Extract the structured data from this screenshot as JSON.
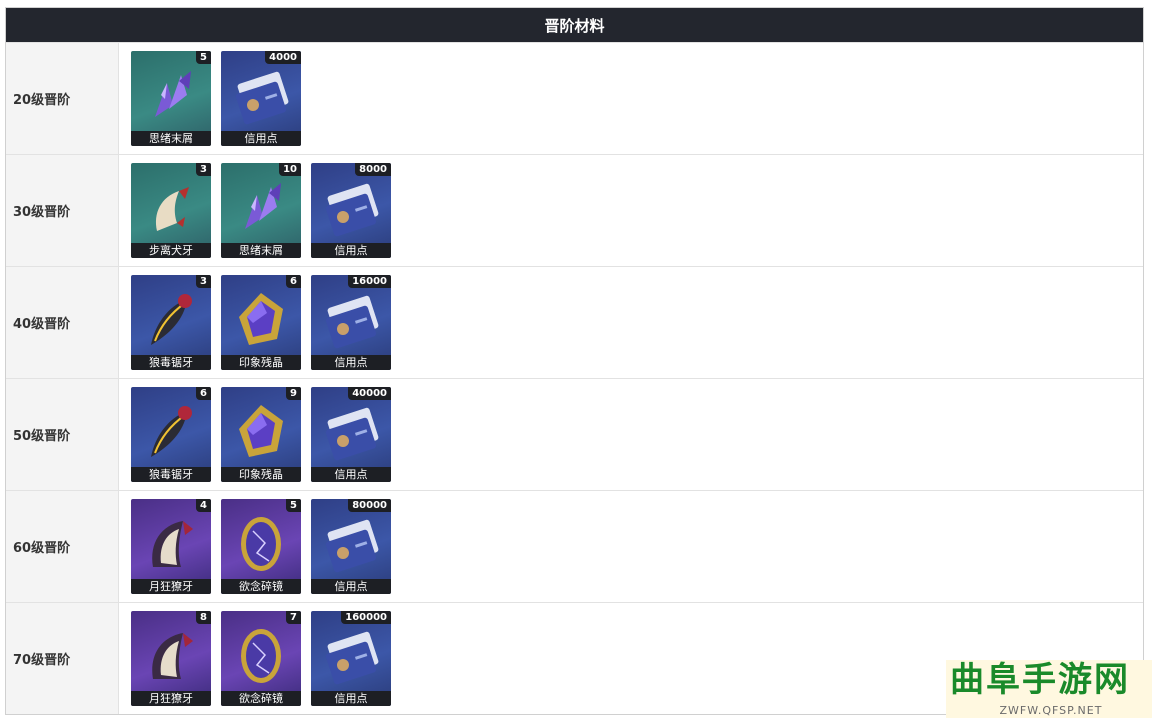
{
  "header": {
    "title": "晋阶材料"
  },
  "colors": {
    "header_bg": "#23262e",
    "teal": "#2c6f6b",
    "blue": "#3c57a8",
    "purple": "#6a45b4"
  },
  "rows": [
    {
      "label": "20级晋阶",
      "items": [
        {
          "name": "思绪末屑",
          "count": "5",
          "icon": "purple-crystal-shards-icon",
          "bg": "teal"
        },
        {
          "name": "信用点",
          "count": "4000",
          "icon": "credit-card-icon",
          "bg": "blue"
        }
      ]
    },
    {
      "label": "30级晋阶",
      "items": [
        {
          "name": "步离犬牙",
          "count": "3",
          "icon": "fang-icon",
          "bg": "teal"
        },
        {
          "name": "思绪末屑",
          "count": "10",
          "icon": "purple-crystal-shards-icon",
          "bg": "teal"
        },
        {
          "name": "信用点",
          "count": "8000",
          "icon": "credit-card-icon",
          "bg": "blue"
        }
      ]
    },
    {
      "label": "40级晋阶",
      "items": [
        {
          "name": "狼毒锯牙",
          "count": "3",
          "icon": "serrated-fang-icon",
          "bg": "blue"
        },
        {
          "name": "印象残晶",
          "count": "6",
          "icon": "gold-crystal-icon",
          "bg": "blue"
        },
        {
          "name": "信用点",
          "count": "16000",
          "icon": "credit-card-icon",
          "bg": "blue"
        }
      ]
    },
    {
      "label": "50级晋阶",
      "items": [
        {
          "name": "狼毒锯牙",
          "count": "6",
          "icon": "serrated-fang-icon",
          "bg": "blue"
        },
        {
          "name": "印象残晶",
          "count": "9",
          "icon": "gold-crystal-icon",
          "bg": "blue"
        },
        {
          "name": "信用点",
          "count": "40000",
          "icon": "credit-card-icon",
          "bg": "blue"
        }
      ]
    },
    {
      "label": "60级晋阶",
      "items": [
        {
          "name": "月狂獠牙",
          "count": "4",
          "icon": "moon-fang-icon",
          "bg": "purple"
        },
        {
          "name": "欲念碎镜",
          "count": "5",
          "icon": "broken-mirror-icon",
          "bg": "purple"
        },
        {
          "name": "信用点",
          "count": "80000",
          "icon": "credit-card-icon",
          "bg": "blue"
        }
      ]
    },
    {
      "label": "70级晋阶",
      "items": [
        {
          "name": "月狂獠牙",
          "count": "8",
          "icon": "moon-fang-icon",
          "bg": "purple"
        },
        {
          "name": "欲念碎镜",
          "count": "7",
          "icon": "broken-mirror-icon",
          "bg": "purple"
        },
        {
          "name": "信用点",
          "count": "160000",
          "icon": "credit-card-icon",
          "bg": "blue"
        }
      ]
    }
  ],
  "watermark": {
    "title": "曲阜手游网",
    "url": "ZWFW.QFSP.NET"
  }
}
